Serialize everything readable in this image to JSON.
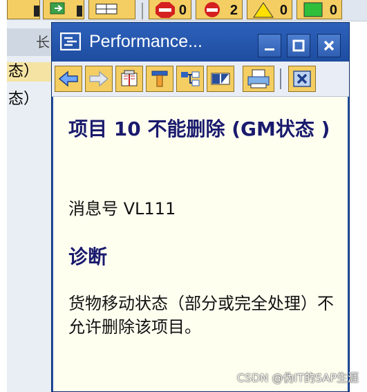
{
  "background": {
    "status_counts": [
      "0",
      "2",
      "0",
      "0"
    ],
    "column_header": "长",
    "rows": [
      "态）",
      "态）"
    ]
  },
  "popup": {
    "title": "Performance...",
    "toolbar": {
      "icons": [
        "back-arrow-icon",
        "forward-arrow-icon",
        "book-icon",
        "tools-icon",
        "split-view-icon",
        "print-icon",
        "close-x-icon"
      ]
    },
    "message_title": "项目 10 不能删除 (GM状态 )",
    "message_number": "消息号 VL111",
    "diagnosis_heading": "诊断",
    "diagnosis_text": "货物移动状态（部分或完全处理）不允许删除该项目。"
  },
  "watermark": "CSDN @伪IT的SAP生涯",
  "colors": {
    "title_bar": "#1f4fa1",
    "content_bg": "#fffff0",
    "heading_text": "#1a1a6e",
    "button_yellow": "#f4ce62"
  }
}
